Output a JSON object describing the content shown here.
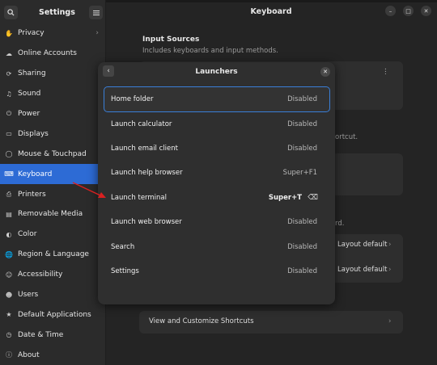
{
  "sidebar": {
    "title": "Settings",
    "items": [
      {
        "label": "Privacy",
        "icon": "hand-icon",
        "chevron": true
      },
      {
        "label": "Online Accounts",
        "icon": "cloud-icon"
      },
      {
        "label": "Sharing",
        "icon": "share-icon"
      },
      {
        "label": "Sound",
        "icon": "speaker-icon"
      },
      {
        "label": "Power",
        "icon": "power-icon"
      },
      {
        "label": "Displays",
        "icon": "monitor-icon"
      },
      {
        "label": "Mouse & Touchpad",
        "icon": "mouse-icon"
      },
      {
        "label": "Keyboard",
        "icon": "keyboard-icon",
        "active": true
      },
      {
        "label": "Printers",
        "icon": "printer-icon"
      },
      {
        "label": "Removable Media",
        "icon": "media-icon"
      },
      {
        "label": "Color",
        "icon": "color-icon"
      },
      {
        "label": "Region & Language",
        "icon": "globe-icon"
      },
      {
        "label": "Accessibility",
        "icon": "accessibility-icon"
      },
      {
        "label": "Users",
        "icon": "users-icon"
      },
      {
        "label": "Default Applications",
        "icon": "star-icon"
      },
      {
        "label": "Date & Time",
        "icon": "clock-icon"
      },
      {
        "label": "About",
        "icon": "info-icon"
      }
    ]
  },
  "header": {
    "title": "Keyboard"
  },
  "background": {
    "input_sources_title": "Input Sources",
    "input_sources_desc": "Includes keyboards and input methods.",
    "partial_text_1": "ortcut.",
    "partial_text_2": "rd.",
    "layout_default_1": "Layout default",
    "layout_default_2": "Layout default",
    "view_shortcuts": "View and Customize Shortcuts"
  },
  "modal": {
    "title": "Launchers",
    "rows": [
      {
        "label": "Home folder",
        "value": "Disabled",
        "focused": true
      },
      {
        "label": "Launch calculator",
        "value": "Disabled"
      },
      {
        "label": "Launch email client",
        "value": "Disabled"
      },
      {
        "label": "Launch help browser",
        "value": "Super+F1"
      },
      {
        "label": "Launch terminal",
        "value": "Super+T",
        "strong": true,
        "clearable": true
      },
      {
        "label": "Launch web browser",
        "value": "Disabled"
      },
      {
        "label": "Search",
        "value": "Disabled"
      },
      {
        "label": "Settings",
        "value": "Disabled"
      }
    ]
  },
  "colors": {
    "accent": "#2d6bd5",
    "annotation_arrow": "#d92020"
  }
}
